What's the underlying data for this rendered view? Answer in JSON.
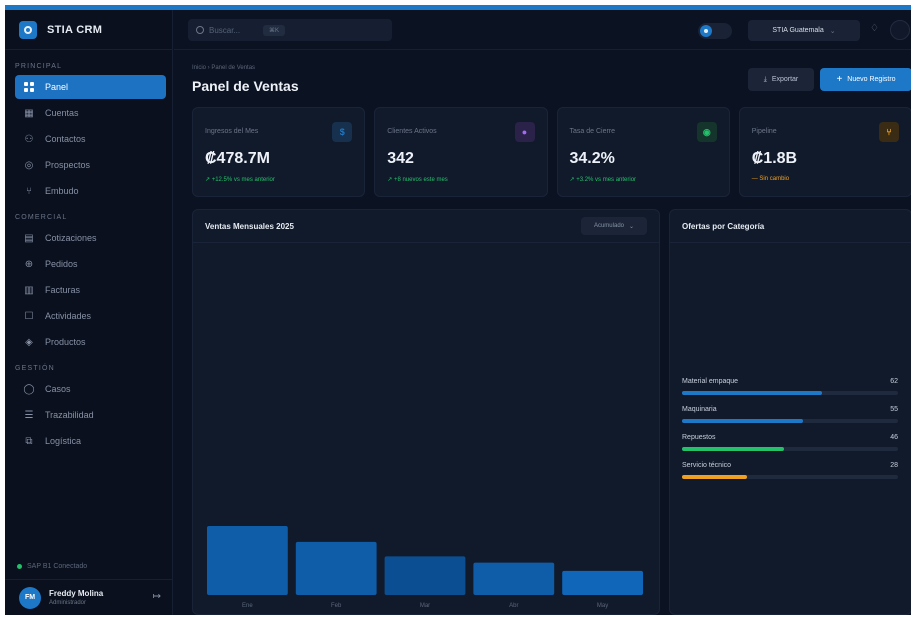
{
  "brand": {
    "name": "STIA CRM"
  },
  "sidebar": {
    "sections": [
      {
        "label": "PRINCIPAL",
        "items": [
          {
            "label": "Panel",
            "icon": "grid-icon",
            "active": true
          },
          {
            "label": "Cuentas",
            "icon": "building-icon"
          },
          {
            "label": "Contactos",
            "icon": "users-icon"
          },
          {
            "label": "Prospectos",
            "icon": "target-icon"
          },
          {
            "label": "Embudo",
            "icon": "funnel-icon"
          }
        ]
      },
      {
        "label": "COMERCIAL",
        "items": [
          {
            "label": "Cotizaciones",
            "icon": "file-icon"
          },
          {
            "label": "Pedidos",
            "icon": "cart-icon"
          },
          {
            "label": "Facturas",
            "icon": "invoice-icon"
          },
          {
            "label": "Actividades",
            "icon": "calendar-icon"
          },
          {
            "label": "Productos",
            "icon": "box-icon"
          }
        ]
      },
      {
        "label": "GESTIÓN",
        "items": [
          {
            "label": "Casos",
            "icon": "chat-icon"
          },
          {
            "label": "Trazabilidad",
            "icon": "list-icon"
          },
          {
            "label": "Logística",
            "icon": "truck-icon"
          }
        ]
      }
    ],
    "status_text": "SAP B1 Conectado",
    "user": {
      "initials": "FM",
      "name": "Freddy Molina",
      "role": "Administrador"
    }
  },
  "topbar": {
    "search_placeholder": "Buscar...",
    "search_shortcut": "⌘K",
    "company": "STIA Guatemala"
  },
  "page": {
    "breadcrumb": "Inicio › Panel de Ventas",
    "title": "Panel de Ventas",
    "export_label": "Exportar",
    "new_label": "Nuevo Registro"
  },
  "kpis": [
    {
      "label": "Ingresos del Mes",
      "value": "₡478.7M",
      "delta": "↗ +12.5% vs mes anterior",
      "icon": "$",
      "icon_color": "#1e78c8",
      "icon_bg": "#16304d",
      "delta_color": "#25c06a"
    },
    {
      "label": "Clientes Activos",
      "value": "342",
      "delta": "↗ +8 nuevos este mes",
      "icon": "●",
      "icon_color": "#a26bf0",
      "icon_bg": "#2a2248",
      "delta_color": "#25c06a"
    },
    {
      "label": "Tasa de Cierre",
      "value": "34.2%",
      "delta": "↗ +3.2% vs mes anterior",
      "icon": "◉",
      "icon_color": "#25c06a",
      "icon_bg": "#15352c",
      "delta_color": "#25c06a"
    },
    {
      "label": "Pipeline",
      "value": "₡1.8B",
      "delta": "— Sin cambio",
      "icon": "⑂",
      "icon_color": "#f0a020",
      "icon_bg": "#3a2c14",
      "delta_color": "#f0a020"
    }
  ],
  "sales_chart": {
    "title": "Ventas Mensuales 2025",
    "filter": "Acumulado",
    "chart_data": {
      "type": "bar",
      "categories": [
        "Ene",
        "Feb",
        "Mar",
        "Abr",
        "May"
      ],
      "values": [
        100,
        77,
        56,
        47,
        35
      ],
      "ylim": [
        0,
        500
      ],
      "grid": false,
      "colors": [
        "#0f5ca8",
        "#0f5ca8",
        "#0b4f92",
        "#0f5ca8",
        "#1066b8"
      ]
    }
  },
  "categories_panel": {
    "title": "Ofertas por Categoría",
    "items": [
      {
        "name": "Material empaque",
        "value": "62",
        "fraction": 0.65,
        "color": "#1e78c8"
      },
      {
        "name": "Maquinaria",
        "value": "55",
        "fraction": 0.56,
        "color": "#1e78c8"
      },
      {
        "name": "Repuestos",
        "value": "46",
        "fraction": 0.47,
        "color": "#25c06a"
      },
      {
        "name": "Servicio técnico",
        "value": "28",
        "fraction": 0.3,
        "color": "#f0a020"
      }
    ]
  }
}
